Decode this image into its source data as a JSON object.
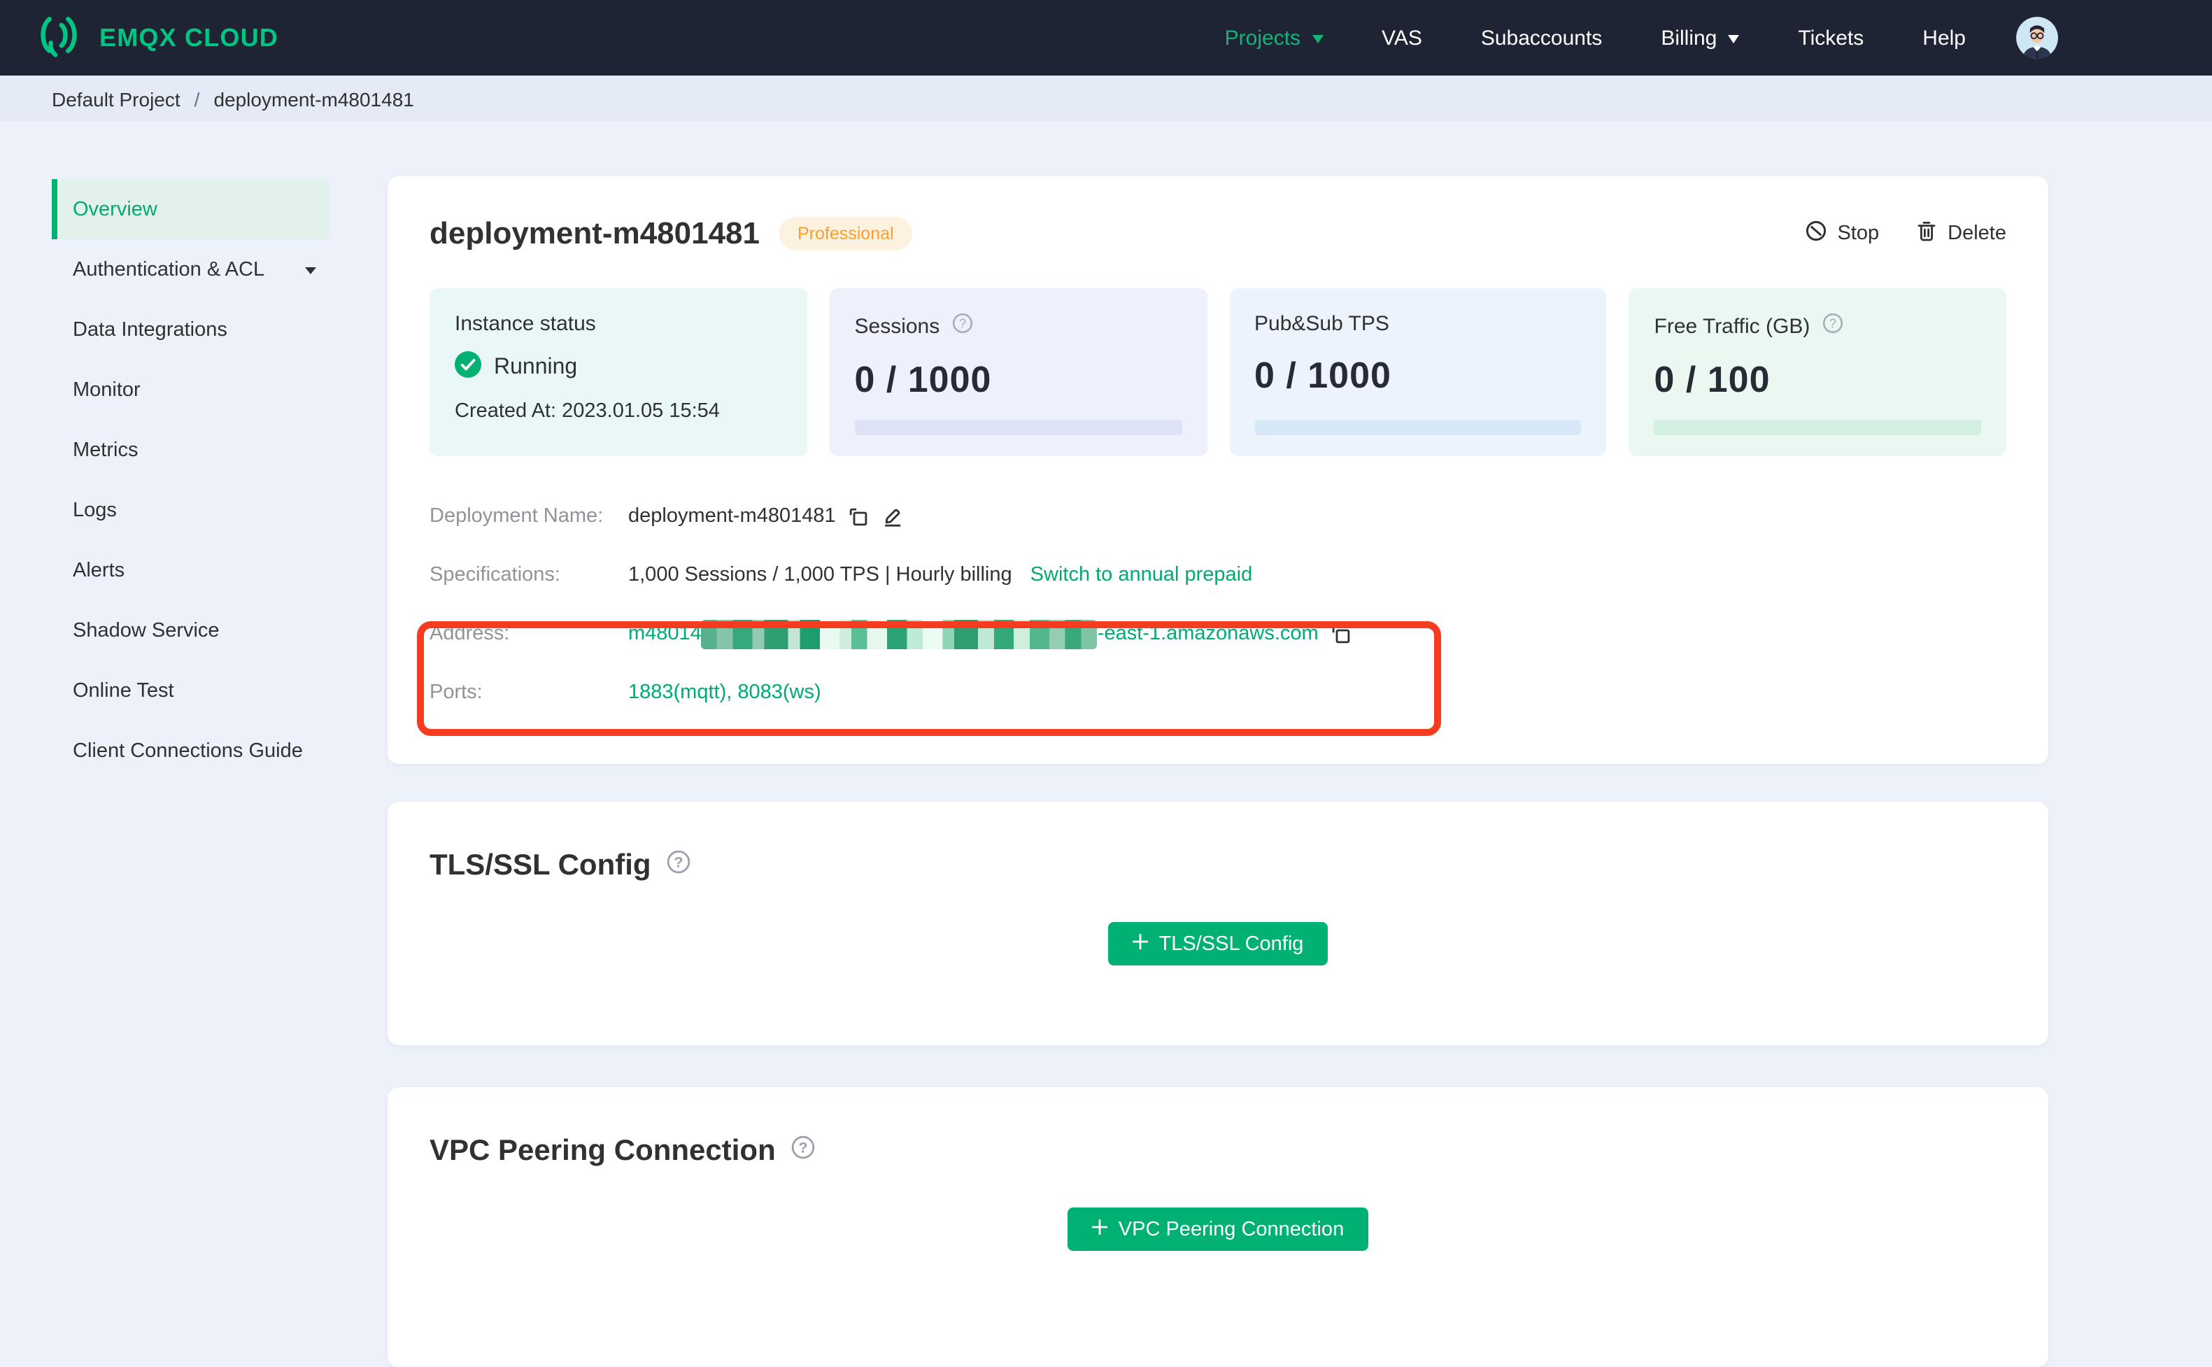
{
  "colors": {
    "accent_green": "#00b173",
    "logo_green": "#00c583",
    "navbar_bg": "#1e2433",
    "annotation_red": "#f63c20",
    "badge_orange": "#ff9e2c"
  },
  "navbar": {
    "logo_text": "EMQX CLOUD",
    "items": [
      {
        "label": "Projects",
        "active": true,
        "has_caret": true
      },
      {
        "label": "VAS"
      },
      {
        "label": "Subaccounts"
      },
      {
        "label": "Billing",
        "has_caret": true
      },
      {
        "label": "Tickets"
      },
      {
        "label": "Help"
      }
    ]
  },
  "breadcrumb": {
    "project": "Default Project",
    "separator": "/",
    "current": "deployment-m4801481"
  },
  "sidebar": {
    "items": [
      {
        "label": "Overview",
        "active": true
      },
      {
        "label": "Authentication & ACL",
        "has_caret": true
      },
      {
        "label": "Data Integrations"
      },
      {
        "label": "Monitor"
      },
      {
        "label": "Metrics"
      },
      {
        "label": "Logs"
      },
      {
        "label": "Alerts"
      },
      {
        "label": "Shadow Service"
      },
      {
        "label": "Online Test"
      },
      {
        "label": "Client Connections Guide"
      }
    ]
  },
  "deployment": {
    "title": "deployment-m4801481",
    "plan_badge": "Professional",
    "actions": {
      "stop": "Stop",
      "delete": "Delete"
    },
    "stats": {
      "instance": {
        "label": "Instance status",
        "status": "Running",
        "created": "Created At: 2023.01.05 15:54"
      },
      "sessions": {
        "label": "Sessions",
        "value": "0 / 1000"
      },
      "pubsub": {
        "label": "Pub&Sub TPS",
        "value": "0 / 1000"
      },
      "traffic": {
        "label": "Free Traffic (GB)",
        "value": "0 / 100"
      }
    },
    "details": {
      "name": {
        "label": "Deployment Name:",
        "value": "deployment-m4801481"
      },
      "specs": {
        "label": "Specifications:",
        "value": "1,000 Sessions / 1,000 TPS | Hourly billing",
        "link": "Switch to annual prepaid"
      },
      "address": {
        "label": "Address:",
        "prefix": "m48014",
        "suffix": "-east-1.amazonaws.com",
        "masked_middle": true
      },
      "ports": {
        "label": "Ports:",
        "value": "1883(mqtt), 8083(ws)"
      }
    }
  },
  "tls_section": {
    "title": "TLS/SSL Config",
    "button_label": "TLS/SSL Config"
  },
  "vpc_section": {
    "title": "VPC Peering Connection",
    "button_label": "VPC Peering Connection"
  },
  "icons": {
    "stop": "circle-slash",
    "delete": "trash",
    "copy": "copy",
    "edit": "pencil",
    "help": "question-circle",
    "status": "check-circle",
    "caret": "chevron-down"
  }
}
